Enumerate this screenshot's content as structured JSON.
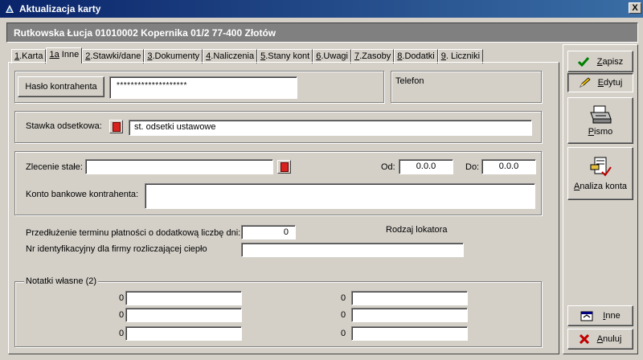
{
  "window": {
    "title": "Aktualizacja karty",
    "close_symbol": "X"
  },
  "header": {
    "text": "Rutkowska Łucja 01010002 Kopernika 01/2 77-400 Złotów"
  },
  "tabs": [
    {
      "num": "1",
      "label": ".Karta"
    },
    {
      "num": "1a",
      "label": " Inne"
    },
    {
      "num": "2",
      "label": ".Stawki/dane"
    },
    {
      "num": "3",
      "label": ".Dokumenty"
    },
    {
      "num": "4",
      "label": ".Naliczenia"
    },
    {
      "num": "5",
      "label": ".Stany kont"
    },
    {
      "num": "6",
      "label": ".Uwagi"
    },
    {
      "num": "7",
      "label": ".Zasoby"
    },
    {
      "num": "8",
      "label": ".Dodatki"
    },
    {
      "num": "9",
      "label": ". Liczniki"
    }
  ],
  "password": {
    "button": "Hasło kontrahenta",
    "value": "********************"
  },
  "phone": {
    "label": "Telefon"
  },
  "rate": {
    "label": "Stawka odsetkowa:",
    "value": "st. odsetki ustawowe"
  },
  "standing": {
    "label": "Zlecenie stałe:",
    "value": "",
    "from_label": "Od:",
    "from_value": "0.0.0",
    "to_label": "Do:",
    "to_value": "0.0.0",
    "account_label": "Konto bankowe kontrahenta:",
    "account_value": ""
  },
  "extension": {
    "label": "Przedłużenie terminu płatności o dodatkową liczbę dni:",
    "value": "0"
  },
  "tenant_type": {
    "label": "Rodzaj lokatora"
  },
  "heat_id": {
    "label": "Nr identyfikacyjny dla firmy rozliczającej ciepło",
    "value": ""
  },
  "notes": {
    "legend": "Notatki własne (2)",
    "left": [
      "0",
      "0",
      "0"
    ],
    "right": [
      "0",
      "0",
      "0"
    ]
  },
  "sidebar": {
    "save": {
      "prefix": "",
      "hot": "Z",
      "rest": "apisz"
    },
    "edit": {
      "prefix": "",
      "hot": "E",
      "rest": "dytuj"
    },
    "letter": {
      "prefix": "",
      "hot": "P",
      "rest": "ismo"
    },
    "analysis": {
      "prefix": "",
      "hot": "A",
      "rest": "naliza konta"
    },
    "other": {
      "prefix": "",
      "hot": "I",
      "rest": "nne"
    },
    "cancel": {
      "prefix": "",
      "hot": "A",
      "rest": "nuluj"
    }
  }
}
